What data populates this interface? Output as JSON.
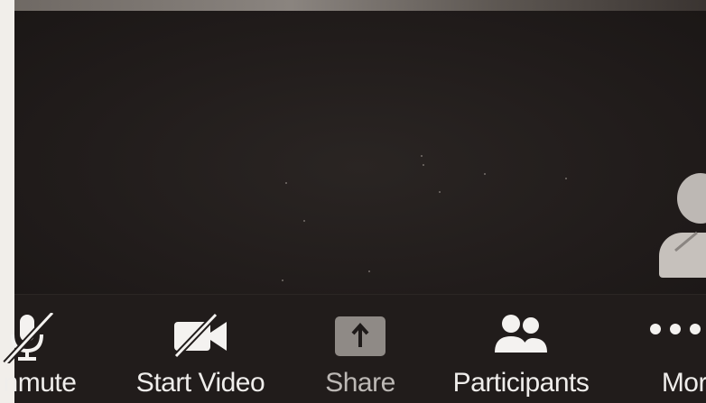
{
  "toolbar": {
    "unmute_label": "nmute",
    "start_video_label": "Start Video",
    "share_label": "Share",
    "participants_label": "Participants",
    "more_label": "More"
  },
  "icons": {
    "unmute": "microphone-muted-icon",
    "start_video": "video-camera-off-icon",
    "share": "share-screen-arrow-icon",
    "participants": "participants-icon",
    "more": "more-dots-icon",
    "avatar": "avatar-placeholder-icon"
  },
  "colors": {
    "background": "#221d1c",
    "toolbar_text": "#efedeb",
    "share_button": "#8f8a86",
    "icon_white": "#f4f2f0"
  }
}
